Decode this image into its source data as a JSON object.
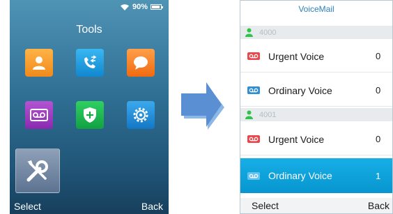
{
  "left_screen": {
    "status": {
      "battery_percent": "90%"
    },
    "title": "Tools",
    "apps": [
      "contacts",
      "calls",
      "messages",
      "voicemail",
      "security",
      "settings",
      "tools"
    ],
    "softkeys": {
      "left": "Select",
      "right": "Back"
    }
  },
  "right_screen": {
    "title": "VoiceMail",
    "accounts": [
      {
        "number": "4000",
        "items": [
          {
            "label": "Urgent Voice",
            "count": "0"
          },
          {
            "label": "Ordinary Voice",
            "count": "0"
          }
        ]
      },
      {
        "number": "4001",
        "items": [
          {
            "label": "Urgent Voice",
            "count": "0"
          },
          {
            "label": "Ordinary Voice",
            "count": "1"
          }
        ]
      }
    ],
    "selected": "4001 Ordinary Voice",
    "softkeys": {
      "left": "Select",
      "right": "Back"
    }
  },
  "colors": {
    "urgent_icon": "#e8474b",
    "ordinary_icon": "#2f8fd5",
    "selection": "#0fa3de",
    "contact_green": "#2ec44a",
    "title_blue": "#2e80bb"
  }
}
